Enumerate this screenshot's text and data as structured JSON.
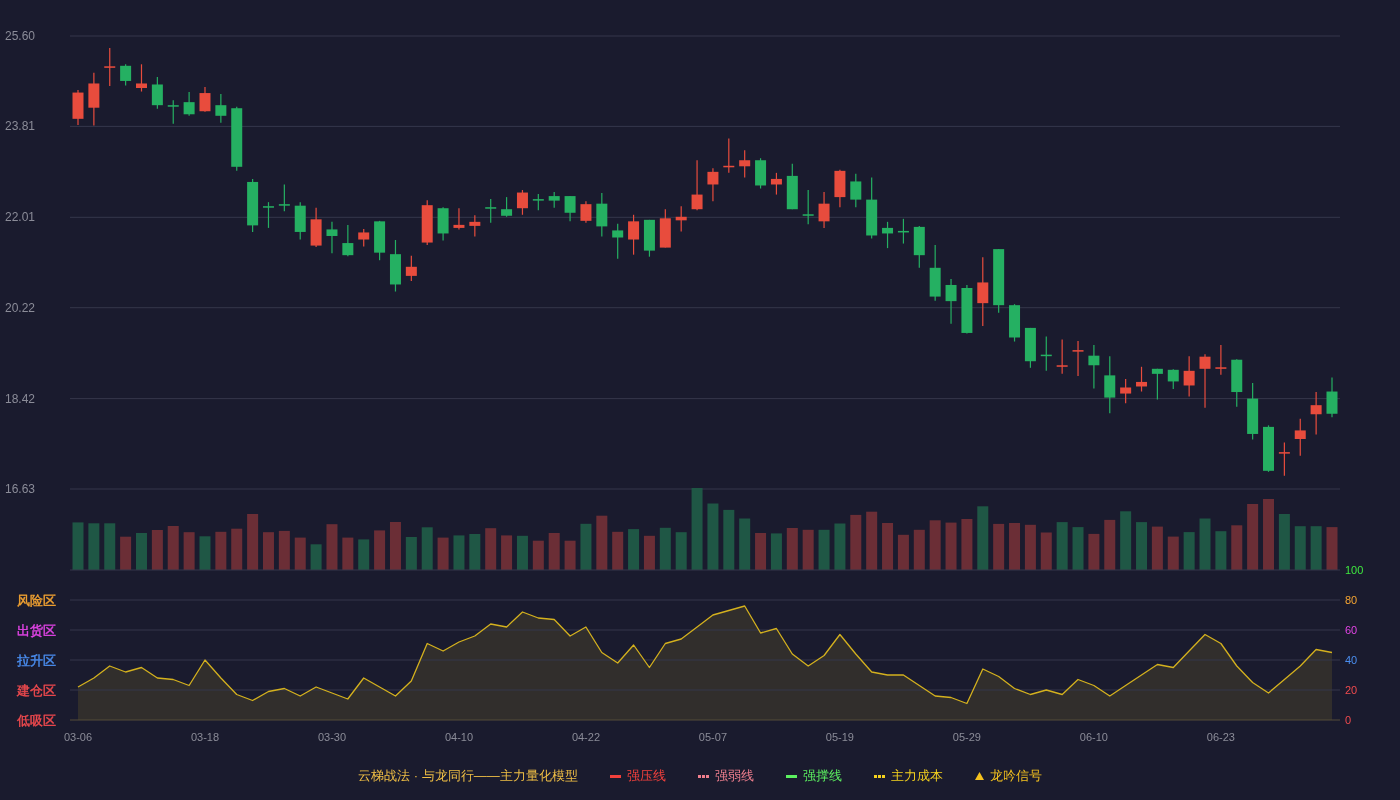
{
  "price_chart": {
    "chart_data": {
      "type": "candlestick",
      "categories": [
        null,
        null,
        null,
        null,
        null,
        null,
        null,
        null,
        null,
        null,
        null,
        null,
        null,
        null,
        null,
        null,
        null,
        null,
        null,
        null,
        null,
        null,
        null,
        null,
        null,
        null,
        null,
        null,
        null,
        null,
        null,
        null,
        null,
        null,
        null,
        null,
        null,
        null,
        null,
        null,
        null,
        null,
        null,
        null,
        null,
        null,
        null,
        null,
        null,
        null,
        null,
        null,
        null,
        null,
        null,
        null,
        null,
        null,
        null,
        null,
        null,
        null,
        null,
        null,
        null,
        null,
        null,
        null,
        null,
        null,
        null,
        null,
        null,
        null,
        null,
        null,
        null,
        null,
        null,
        null
      ],
      "ylim": [
        16.63,
        25.6
      ],
      "yticks": [
        {
          "value": 25.6,
          "label": "25.60"
        },
        {
          "value": 23.81,
          "label": "23.81"
        },
        {
          "value": 22.01,
          "label": "22.01"
        },
        {
          "value": 20.22,
          "label": "20.22"
        },
        {
          "value": 18.42,
          "label": "18.42"
        },
        {
          "value": 16.63,
          "label": "16.63"
        }
      ],
      "grid": true,
      "ohlc": [
        [
          23.96,
          24.53,
          23.84,
          24.48
        ],
        [
          24.18,
          24.87,
          23.83,
          24.66
        ],
        [
          24.97,
          25.36,
          24.61,
          25.0
        ],
        [
          25.01,
          25.04,
          24.62,
          24.71
        ],
        [
          24.57,
          25.04,
          24.5,
          24.66
        ],
        [
          24.64,
          24.79,
          24.16,
          24.23
        ],
        [
          24.23,
          24.33,
          23.86,
          24.2
        ],
        [
          24.29,
          24.49,
          24.02,
          24.05
        ],
        [
          24.11,
          24.59,
          24.1,
          24.47
        ],
        [
          24.23,
          24.45,
          23.88,
          24.02
        ],
        [
          24.17,
          24.2,
          22.93,
          23.01
        ],
        [
          22.71,
          22.77,
          21.72,
          21.85
        ],
        [
          22.23,
          22.31,
          21.8,
          22.2
        ],
        [
          22.27,
          22.66,
          22.13,
          22.24
        ],
        [
          22.24,
          22.31,
          21.57,
          21.72
        ],
        [
          21.45,
          22.2,
          21.42,
          21.97
        ],
        [
          21.77,
          21.92,
          21.3,
          21.64
        ],
        [
          21.5,
          21.86,
          21.24,
          21.26
        ],
        [
          21.57,
          21.78,
          21.43,
          21.71
        ],
        [
          21.93,
          21.94,
          21.16,
          21.31
        ],
        [
          21.28,
          21.56,
          20.54,
          20.68
        ],
        [
          20.85,
          21.25,
          20.75,
          21.03
        ],
        [
          21.51,
          22.35,
          21.46,
          22.25
        ],
        [
          22.19,
          22.21,
          21.55,
          21.69
        ],
        [
          21.8,
          22.19,
          21.77,
          21.86
        ],
        [
          21.84,
          22.05,
          21.63,
          21.92
        ],
        [
          22.21,
          22.37,
          21.9,
          22.18
        ],
        [
          22.17,
          22.41,
          22.02,
          22.04
        ],
        [
          22.19,
          22.55,
          22.06,
          22.5
        ],
        [
          22.37,
          22.47,
          22.15,
          22.34
        ],
        [
          22.43,
          22.51,
          22.2,
          22.34
        ],
        [
          22.43,
          22.43,
          21.93,
          22.1
        ],
        [
          21.94,
          22.33,
          21.9,
          22.27
        ],
        [
          22.28,
          22.49,
          21.63,
          21.83
        ],
        [
          21.75,
          21.88,
          21.19,
          21.61
        ],
        [
          21.57,
          22.06,
          21.27,
          21.93
        ],
        [
          21.96,
          21.96,
          21.23,
          21.35
        ],
        [
          21.41,
          22.17,
          21.41,
          21.99
        ],
        [
          21.95,
          22.23,
          21.73,
          22.02
        ],
        [
          22.17,
          23.14,
          22.15,
          22.46
        ],
        [
          22.66,
          22.98,
          22.33,
          22.91
        ],
        [
          23.0,
          23.57,
          22.89,
          23.03
        ],
        [
          23.02,
          23.34,
          22.8,
          23.14
        ],
        [
          23.14,
          23.18,
          22.58,
          22.64
        ],
        [
          22.66,
          22.89,
          22.46,
          22.77
        ],
        [
          22.83,
          23.07,
          22.17,
          22.17
        ],
        [
          22.07,
          22.55,
          21.87,
          22.04
        ],
        [
          21.93,
          22.51,
          21.8,
          22.28
        ],
        [
          22.41,
          22.95,
          22.21,
          22.93
        ],
        [
          22.72,
          22.87,
          22.21,
          22.36
        ],
        [
          22.36,
          22.8,
          21.59,
          21.65
        ],
        [
          21.8,
          21.92,
          21.4,
          21.69
        ],
        [
          21.74,
          21.98,
          21.49,
          21.71
        ],
        [
          21.82,
          21.84,
          21.01,
          21.26
        ],
        [
          21.01,
          21.46,
          20.36,
          20.44
        ],
        [
          20.67,
          20.79,
          19.9,
          20.35
        ],
        [
          20.61,
          20.67,
          19.71,
          19.72
        ],
        [
          20.31,
          21.22,
          19.86,
          20.72
        ],
        [
          21.38,
          21.38,
          20.12,
          20.27
        ],
        [
          20.27,
          20.29,
          19.55,
          19.63
        ],
        [
          19.82,
          19.82,
          19.03,
          19.16
        ],
        [
          19.29,
          19.65,
          18.97,
          19.26
        ],
        [
          19.05,
          19.59,
          18.91,
          19.08
        ],
        [
          19.35,
          19.56,
          18.87,
          19.38
        ],
        [
          19.27,
          19.48,
          18.62,
          19.08
        ],
        [
          18.88,
          19.26,
          18.13,
          18.44
        ],
        [
          18.52,
          18.81,
          18.33,
          18.64
        ],
        [
          18.66,
          19.05,
          18.56,
          18.75
        ],
        [
          19.01,
          19.01,
          18.4,
          18.91
        ],
        [
          18.99,
          19.0,
          18.61,
          18.76
        ],
        [
          18.68,
          19.26,
          18.46,
          18.97
        ],
        [
          19.01,
          19.3,
          18.24,
          19.25
        ],
        [
          19.01,
          19.48,
          18.89,
          19.04
        ],
        [
          19.19,
          19.2,
          18.26,
          18.55
        ],
        [
          18.42,
          18.73,
          17.61,
          17.72
        ],
        [
          17.86,
          17.89,
          16.97,
          16.99
        ],
        [
          17.33,
          17.55,
          16.89,
          17.36
        ],
        [
          17.62,
          18.02,
          17.29,
          17.79
        ],
        [
          18.11,
          18.55,
          17.71,
          18.29
        ],
        [
          18.56,
          18.84,
          18.05,
          18.12
        ]
      ]
    }
  },
  "indicator": {
    "zones": [
      {
        "label": "风险区",
        "color": "#f5a431"
      },
      {
        "label": "出货区",
        "color": "#e244e6"
      },
      {
        "label": "拉升区",
        "color": "#4a8ef0"
      },
      {
        "label": "建仓区",
        "color": "#f04a4e"
      },
      {
        "label": "低吸区",
        "color": "#f04a4e"
      }
    ],
    "chart_data": {
      "type": "area",
      "categories": [
        "03-06",
        null,
        null,
        null,
        null,
        null,
        null,
        null,
        "03-18",
        null,
        null,
        null,
        null,
        null,
        null,
        null,
        "03-30",
        null,
        null,
        null,
        null,
        null,
        null,
        null,
        "04-10",
        null,
        null,
        null,
        null,
        null,
        null,
        null,
        "04-22",
        null,
        null,
        null,
        null,
        null,
        null,
        null,
        "05-07",
        null,
        null,
        null,
        null,
        null,
        null,
        null,
        "05-19",
        null,
        null,
        null,
        null,
        null,
        null,
        null,
        "05-29",
        null,
        null,
        null,
        null,
        null,
        null,
        null,
        "06-10",
        null,
        null,
        null,
        null,
        null,
        null,
        null,
        "06-23",
        null,
        null,
        null,
        null,
        null,
        null,
        null
      ],
      "ylim": [
        0,
        100
      ],
      "yticks": [
        0,
        20,
        40,
        60,
        80,
        100
      ],
      "grid": true,
      "series": [
        {
          "color": "#d4b11e",
          "values": [
            22,
            28,
            36,
            32,
            35,
            28,
            27,
            23,
            40,
            28,
            17,
            13,
            19,
            21,
            16,
            22,
            18,
            14,
            28,
            22,
            16,
            26,
            51,
            46,
            52,
            56,
            64,
            62,
            72,
            68,
            67,
            56,
            62,
            45,
            38,
            50,
            35,
            51,
            54,
            62,
            70,
            73,
            76,
            58,
            61,
            44,
            36,
            43,
            57,
            44,
            32,
            30,
            30,
            23,
            16,
            15,
            11,
            34,
            29,
            21,
            17,
            20,
            17,
            27,
            23,
            16,
            23,
            30,
            37,
            35,
            46,
            57,
            51,
            36,
            25,
            18,
            27,
            36,
            47,
            45
          ]
        }
      ]
    }
  },
  "legend": {
    "title": "云梯战法 · 与龙同行——主力量化模型",
    "items": [
      {
        "label": "强压线",
        "kind": "solid",
        "color": "#f2403c"
      },
      {
        "label": "强弱线",
        "kind": "dashed",
        "color": "#f07f8e"
      },
      {
        "label": "强撑线",
        "kind": "solid",
        "color": "#5cf060"
      },
      {
        "label": "主力成本",
        "kind": "dashed",
        "color": "#f5d21e"
      },
      {
        "label": "龙吟信号",
        "kind": "triangle",
        "color": "#f5c21e"
      }
    ]
  }
}
